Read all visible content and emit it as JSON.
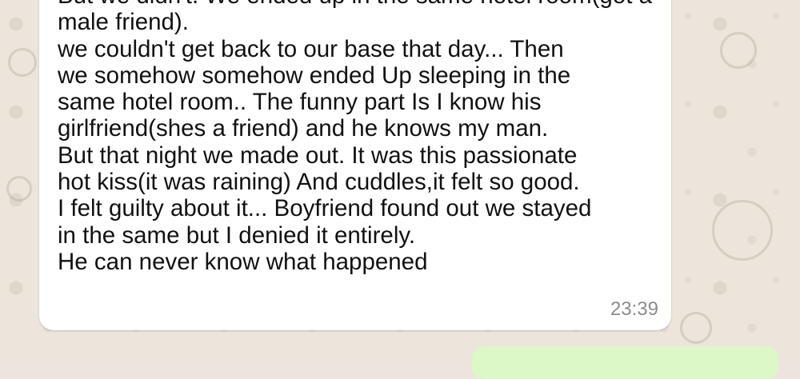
{
  "chat": {
    "incoming_message": {
      "lines": [
        "But we didn't. We ended up in the same hotel room(got a",
        "male friend).",
        "we couldn't get back to our base that day... Then",
        "we somehow somehow ended Up sleeping in the",
        "same hotel room.. The funny part Is I know his",
        "girlfriend(shes a friend) and he knows my man.",
        "But that night we made out. It was this passionate",
        "hot kiss(it was raining) And cuddles,it felt so good.",
        "I felt guilty about it... Boyfriend found out we stayed",
        "in the same but I denied it entirely.",
        "He can never know what happened"
      ],
      "time": "23:39"
    },
    "outgoing_message": {
      "visible": true
    }
  },
  "colors": {
    "wallpaper": "#ebe5dc",
    "incoming_bubble": "#ffffff",
    "outgoing_bubble": "#dcf8c6",
    "timestamp": "#8c8c8c"
  }
}
